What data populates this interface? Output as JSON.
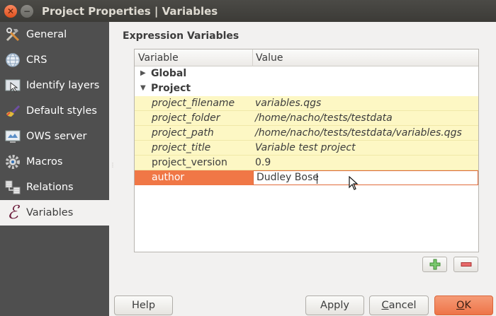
{
  "window": {
    "title": "Project Properties | Variables"
  },
  "sidebar": {
    "items": [
      {
        "label": "General",
        "icon": "tools-icon"
      },
      {
        "label": "CRS",
        "icon": "globe-icon"
      },
      {
        "label": "Identify layers",
        "icon": "identify-icon"
      },
      {
        "label": "Default styles",
        "icon": "paintbrush-icon"
      },
      {
        "label": "OWS server",
        "icon": "monitor-icon"
      },
      {
        "label": "Macros",
        "icon": "gear-icon"
      },
      {
        "label": "Relations",
        "icon": "relations-icon"
      },
      {
        "label": "Variables",
        "icon": "epsilon-icon",
        "active": true,
        "glyph": "ℰ"
      }
    ]
  },
  "main": {
    "section_title": "Expression Variables",
    "columns": {
      "variable": "Variable",
      "value": "Value"
    },
    "groups": {
      "global": {
        "label": "Global",
        "expanded": false
      },
      "project": {
        "label": "Project",
        "expanded": true
      }
    },
    "rows": [
      {
        "name": "project_filename",
        "value": "variables.qgs"
      },
      {
        "name": "project_folder",
        "value": "/home/nacho/tests/testdata"
      },
      {
        "name": "project_path",
        "value": "/home/nacho/tests/testdata/variables.qgs"
      },
      {
        "name": "project_title",
        "value": "Variable test project"
      },
      {
        "name": "project_version",
        "value": "0.9"
      }
    ],
    "editing_row": {
      "name": "author",
      "value": "Dudley Bose"
    }
  },
  "buttons": {
    "help": "Help",
    "apply": "Apply",
    "cancel_prefix": "",
    "cancel_mnemonic": "C",
    "cancel_rest": "ancel",
    "ok_mnemonic": "O",
    "ok_rest": "K"
  },
  "colors": {
    "accent": "#f07746",
    "sidebar_bg": "#4f4f4f",
    "variable_row_bg": "#fdf7c4"
  }
}
